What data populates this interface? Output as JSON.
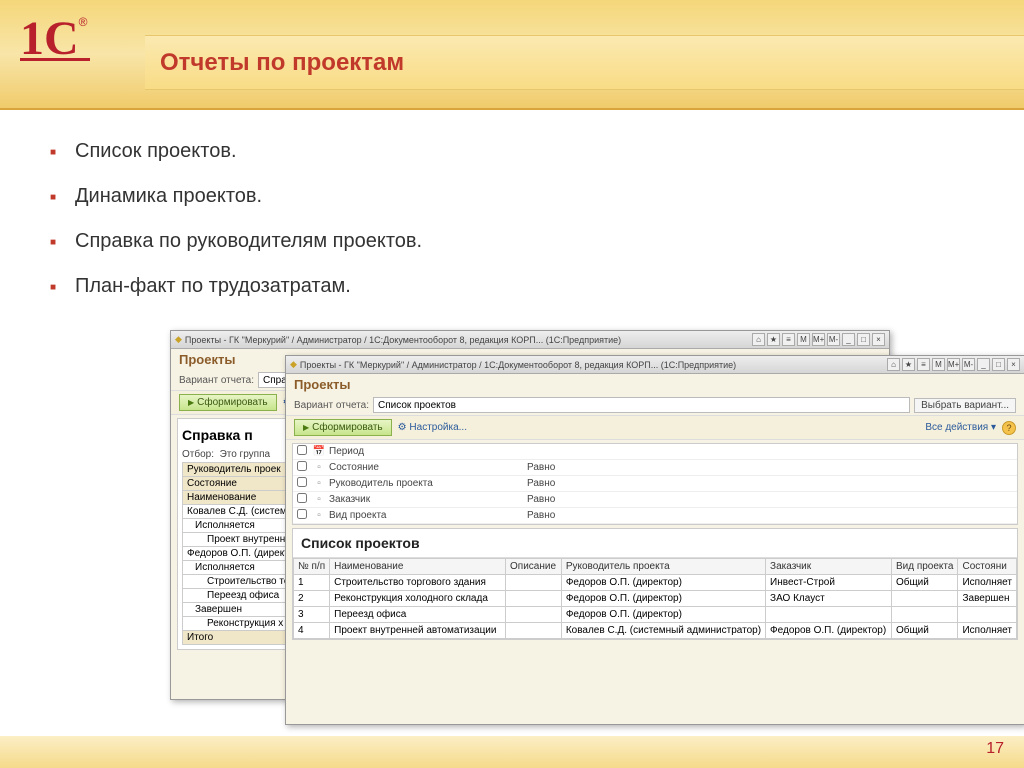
{
  "slide": {
    "title": "Отчеты по проектам",
    "page_number": "17",
    "bullets": [
      "Список проектов.",
      "Динамика проектов.",
      "Справка по руководителям проектов.",
      "План-факт по трудозатратам."
    ]
  },
  "win1": {
    "titlebar": "Проекты - ГК \"Меркурий\" / Администратор / 1С:Документооборот 8, редакция КОРП... (1С:Предприятие)",
    "module": "Проекты",
    "variant_label": "Вариант отчета:",
    "variant_value": "Справка по рук",
    "form_btn": "Сформировать",
    "settings": "Настройка...",
    "report_title": "Справка п",
    "filter_label": "Отбор:",
    "filter_text": "Это группа",
    "headers": [
      "Руководитель проек",
      "Состояние",
      "Наименование"
    ],
    "rows": [
      "Ковалев С.Д. (системн",
      "Исполняется",
      "Проект внутренн",
      "Федоров О.П. (директо",
      "Исполняется",
      "Строительство то",
      "Переезд офиса",
      "Завершен",
      "Реконструкция х"
    ],
    "total": "Итого"
  },
  "win2": {
    "titlebar": "Проекты - ГК \"Меркурий\" / Администратор / 1С:Документооборот 8, редакция КОРП... (1С:Предприятие)",
    "module": "Проекты",
    "variant_label": "Вариант отчета:",
    "variant_value": "Список проектов",
    "variant_btn": "Выбрать вариант...",
    "form_btn": "Сформировать",
    "settings": "Настройка...",
    "all_actions": "Все действия ▾",
    "filters": [
      {
        "label": "Период",
        "op": ""
      },
      {
        "label": "Состояние",
        "op": "Равно"
      },
      {
        "label": "Руководитель проекта",
        "op": "Равно"
      },
      {
        "label": "Заказчик",
        "op": "Равно"
      },
      {
        "label": "Вид проекта",
        "op": "Равно"
      }
    ],
    "report_title": "Список проектов",
    "columns": [
      "№ п/п",
      "Наименование",
      "Описание",
      "Руководитель проекта",
      "Заказчик",
      "Вид проекта",
      "Состояни"
    ],
    "rows": [
      {
        "n": "1",
        "name": "Строительство торгового здания",
        "desc": "",
        "mgr": "Федоров О.П. (директор)",
        "cust": "Инвест-Строй",
        "type": "Общий",
        "st": "Исполняет"
      },
      {
        "n": "2",
        "name": "Реконструкция холодного склада",
        "desc": "",
        "mgr": "Федоров О.П. (директор)",
        "cust": "ЗАО Клауст",
        "type": "",
        "st": "Завершен"
      },
      {
        "n": "3",
        "name": "Переезд офиса",
        "desc": "",
        "mgr": "Федоров О.П. (директор)",
        "cust": "",
        "type": "",
        "st": ""
      },
      {
        "n": "4",
        "name": "Проект внутренней автоматизации",
        "desc": "",
        "mgr": "Ковалев С.Д. (системный администратор)",
        "cust": "Федоров О.П. (директор)",
        "type": "Общий",
        "st": "Исполняет"
      }
    ]
  }
}
